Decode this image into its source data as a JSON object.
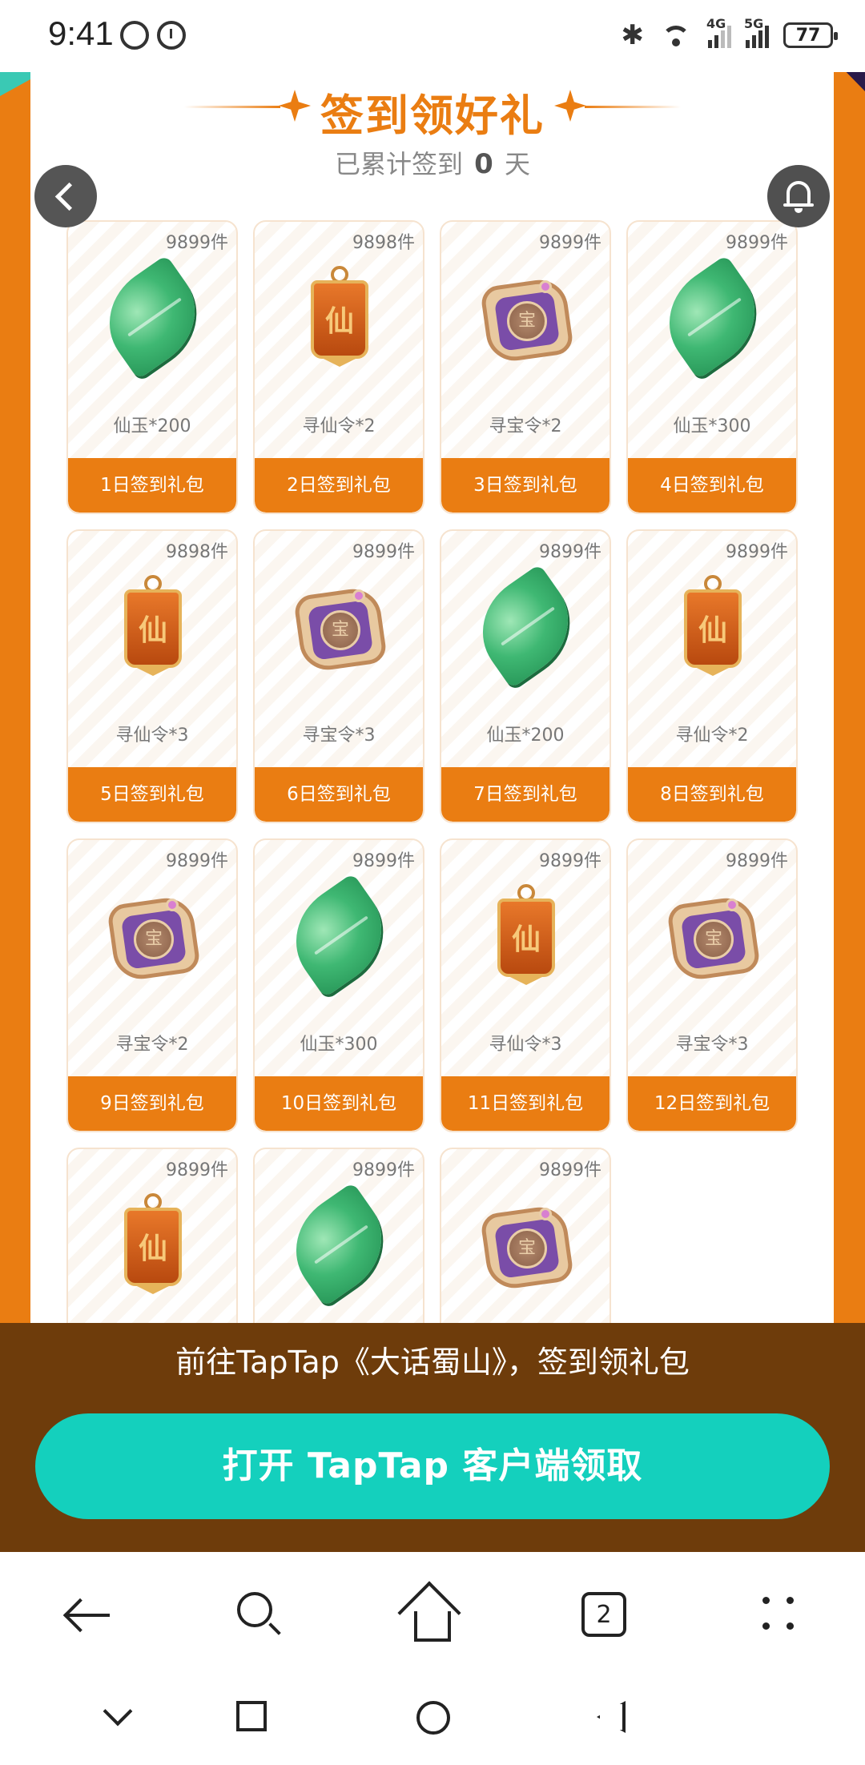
{
  "status_bar": {
    "time": "9:41",
    "battery": "77",
    "signal_labels": [
      "4G",
      "5G"
    ]
  },
  "header": {
    "title": "签到领好礼",
    "subtitle_prefix": "已累计签到",
    "days_count": "0",
    "subtitle_suffix": "天"
  },
  "icons": {
    "back": "chevron-left-icon",
    "notify": "bell-icon",
    "jade": "jade-leaf-icon",
    "xianling": "immortal-token-icon",
    "baoling": "treasure-seal-icon"
  },
  "cards": [
    {
      "stock": "9899件",
      "item": "仙玉*200",
      "pack": "1日签到礼包",
      "icon": "jade"
    },
    {
      "stock": "9898件",
      "item": "寻仙令*2",
      "pack": "2日签到礼包",
      "icon": "xian"
    },
    {
      "stock": "9899件",
      "item": "寻宝令*2",
      "pack": "3日签到礼包",
      "icon": "seal"
    },
    {
      "stock": "9899件",
      "item": "仙玉*300",
      "pack": "4日签到礼包",
      "icon": "jade"
    },
    {
      "stock": "9898件",
      "item": "寻仙令*3",
      "pack": "5日签到礼包",
      "icon": "xian"
    },
    {
      "stock": "9899件",
      "item": "寻宝令*3",
      "pack": "6日签到礼包",
      "icon": "seal"
    },
    {
      "stock": "9899件",
      "item": "仙玉*200",
      "pack": "7日签到礼包",
      "icon": "jade"
    },
    {
      "stock": "9899件",
      "item": "寻仙令*2",
      "pack": "8日签到礼包",
      "icon": "xian"
    },
    {
      "stock": "9899件",
      "item": "寻宝令*2",
      "pack": "9日签到礼包",
      "icon": "seal"
    },
    {
      "stock": "9899件",
      "item": "仙玉*300",
      "pack": "10日签到礼包",
      "icon": "jade"
    },
    {
      "stock": "9899件",
      "item": "寻仙令*3",
      "pack": "11日签到礼包",
      "icon": "xian"
    },
    {
      "stock": "9899件",
      "item": "寻宝令*3",
      "pack": "12日签到礼包",
      "icon": "seal"
    },
    {
      "stock": "9899件",
      "item": "",
      "pack": "",
      "icon": "xian"
    },
    {
      "stock": "9899件",
      "item": "",
      "pack": "",
      "icon": "jade"
    },
    {
      "stock": "9899件",
      "item": "",
      "pack": "",
      "icon": "seal"
    }
  ],
  "banner": {
    "text": "前往TapTap《大话蜀山》，签到领礼包",
    "button": "打开 TapTap 客户端领取"
  },
  "browser_bar": {
    "tab_count": "2"
  },
  "colors": {
    "accent_orange": "#ea7d12",
    "banner_brown": "#6e3c0b",
    "button_teal": "#14d0bd"
  }
}
